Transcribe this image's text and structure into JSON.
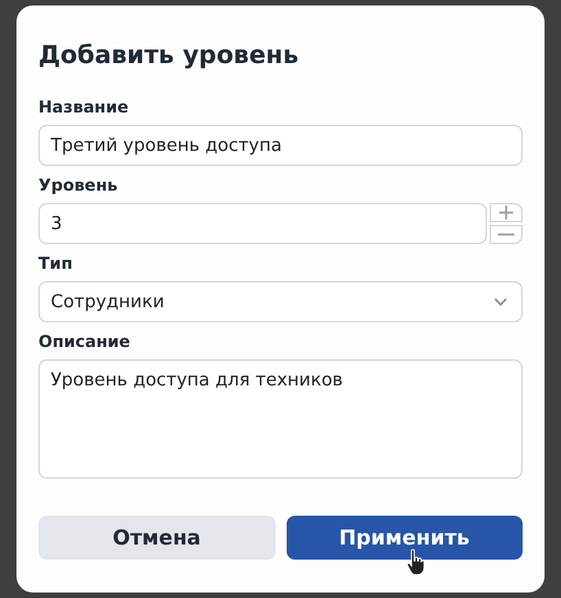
{
  "dialog": {
    "title": "Добавить уровень",
    "fields": [
      {
        "kind": "text",
        "label": "Название",
        "value": "Третий уровень доступа"
      },
      {
        "kind": "number",
        "label": "Уровень",
        "value": "3"
      },
      {
        "kind": "select",
        "label": "Тип",
        "value": "Сотрудники"
      },
      {
        "kind": "textarea",
        "label": "Описание",
        "value": "Уровень доступа для техников"
      }
    ],
    "buttons": [
      {
        "label": "Отмена",
        "kind": "secondary"
      },
      {
        "label": "Применить",
        "kind": "primary"
      }
    ]
  }
}
